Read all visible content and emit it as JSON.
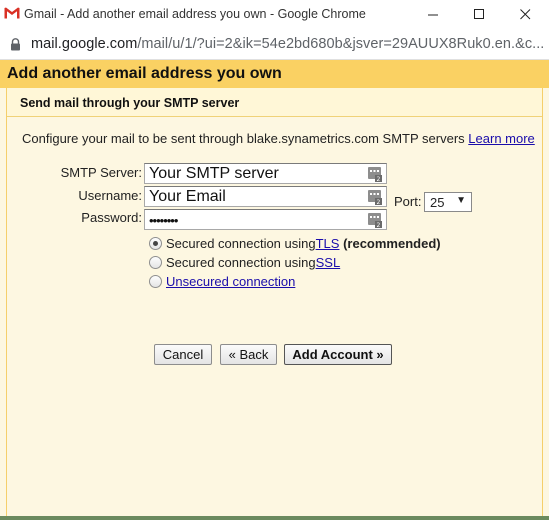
{
  "window": {
    "title": "Gmail - Add another email address you own - Google Chrome",
    "minimize_glyph": "—",
    "maximize_glyph": "☐",
    "close_glyph": "✕"
  },
  "address_bar": {
    "host": "mail.google.com",
    "path": "/mail/u/1/?ui=2&ik=54e2bd680b&jsver=29AUUX8Ruk0.en.&c..."
  },
  "dialog": {
    "title": "Add another email address you own",
    "section_title": "Send mail through your SMTP server",
    "description": "Configure your mail to be sent through blake.synametrics.com SMTP servers",
    "learn_more": "Learn more",
    "fields": {
      "smtp_server_label": "SMTP Server:",
      "smtp_server_value": "Your SMTP server",
      "port_label": "Port:",
      "port_value": "25",
      "username_label": "Username:",
      "username_value": "Your Email",
      "password_label": "Password:",
      "password_value": "••••••••"
    },
    "security_options": {
      "tls_prefix": "Secured connection using ",
      "tls_link": "TLS",
      "tls_suffix": "(recommended)",
      "ssl_prefix": "Secured connection using ",
      "ssl_link": "SSL",
      "unsecured_link": "Unsecured connection",
      "selected": "tls"
    },
    "buttons": {
      "cancel": "Cancel",
      "back": "« Back",
      "add_account": "Add Account »"
    }
  },
  "colors": {
    "header_yellow": "#fad163",
    "dialog_bg": "#fdf7e1",
    "link_blue": "#1a0dab"
  }
}
